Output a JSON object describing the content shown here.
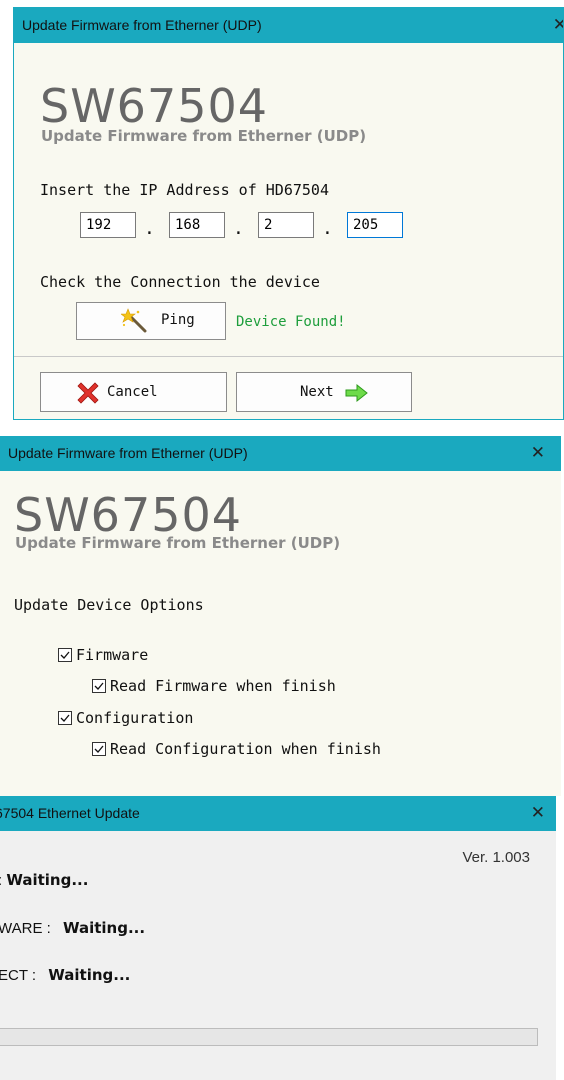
{
  "window1": {
    "title": "Update Firmware from Etherner (UDP)",
    "close_glyph": "✕",
    "product": "SW67504",
    "subtitle": "Update Firmware from Etherner (UDP)",
    "ip_label": "Insert the IP Address of  HD67504",
    "ip": [
      "192",
      "168",
      "2",
      "205"
    ],
    "ip_separator": ".",
    "check_label": "Check the Connection the device",
    "ping_label": "Ping",
    "ping_icon": "magic-wand-icon",
    "status": "Device Found!",
    "cancel_label": "Cancel",
    "cancel_icon": "red-x-icon",
    "next_label": "Next",
    "next_icon": "green-arrow-right-icon",
    "colors": {
      "titlebar": "#1aa9bf",
      "status": "#1e9e3c"
    }
  },
  "window2": {
    "title": "Update Firmware from Etherner (UDP)",
    "close_glyph": "✕",
    "product": "SW67504",
    "subtitle": "Update Firmware from Etherner (UDP)",
    "options_label": "Update Device Options",
    "options": [
      {
        "label": "Firmware",
        "checked": true
      },
      {
        "label": "Read Firmware when finish",
        "checked": true
      },
      {
        "label": "Configuration",
        "checked": true
      },
      {
        "label": "Read Configuration when finish",
        "checked": true
      }
    ]
  },
  "window3": {
    "title": "67504 Ethernet Update",
    "close_glyph": "✕",
    "version": "Ver. 1.003",
    "rows": [
      {
        "label": ":",
        "status": "Waiting..."
      },
      {
        "label": "WARE :",
        "status": "Waiting..."
      },
      {
        "label": "ECT :",
        "status": "Waiting..."
      }
    ],
    "progress": 0
  }
}
